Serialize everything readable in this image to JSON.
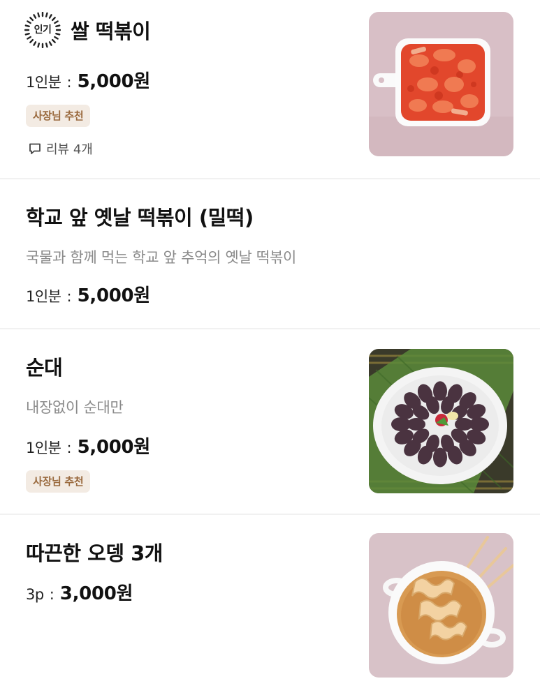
{
  "menu": {
    "items": [
      {
        "badge": "인기",
        "title": "쌀 떡볶이",
        "price_unit": "1인분",
        "price_sep": ":",
        "price": "5,000원",
        "tag": "사장님 추천",
        "review": "리뷰 4개",
        "image_icon": "tteokbokki-photo"
      },
      {
        "title": "학교 앞 옛날 떡볶이 (밀떡)",
        "description": "국물과 함께 먹는 학교 앞 추억의 옛날 떡볶이",
        "price_unit": "1인분",
        "price_sep": ":",
        "price": "5,000원"
      },
      {
        "title": "순대",
        "description": "내장없이 순대만",
        "price_unit": "1인분",
        "price_sep": ":",
        "price": "5,000원",
        "tag": "사장님 추천",
        "image_icon": "sundae-photo"
      },
      {
        "title": "따끈한 오뎅 3개",
        "price_unit": "3p",
        "price_sep": ":",
        "price": "3,000원",
        "image_icon": "odeng-photo"
      }
    ]
  },
  "colors": {
    "tag_bg": "#f3ebe3",
    "tag_text": "#9a6a3e",
    "desc_text": "#8a8a8a",
    "divider": "#f1f1f1"
  }
}
